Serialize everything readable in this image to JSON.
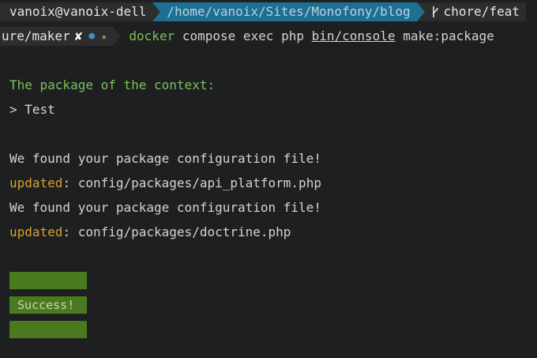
{
  "prompt": {
    "user_host": "vanoix@vanoix-dell",
    "path": "/home/vanoix/Sites/Monofony/blog",
    "git_icon": "git-branch-icon",
    "branch_start": "chore/feat",
    "branch_end": "ure/maker",
    "dirty_mark": "✘",
    "staged_mark": "●",
    "untracked_mark": "★"
  },
  "command": {
    "binary": "docker",
    "args_before": " compose exec php ",
    "script": "bin/console",
    "args_after": " make:package"
  },
  "output": {
    "question": "The package of the context:",
    "answer": "> Test",
    "found_1": "We found your package configuration file!",
    "updated_label_1": "updated",
    "updated_file_1": ": config/packages/api_platform.php",
    "found_2": "We found your package configuration file!",
    "updated_label_2": "updated",
    "updated_file_2": ": config/packages/doctrine.php",
    "success": "Success!"
  },
  "colors": {
    "background": "#1e1f21",
    "path_segment": "#1f6f93",
    "success_block": "#4a7a1e",
    "question_green": "#7cc25a",
    "updated_orange": "#d7a22c"
  }
}
